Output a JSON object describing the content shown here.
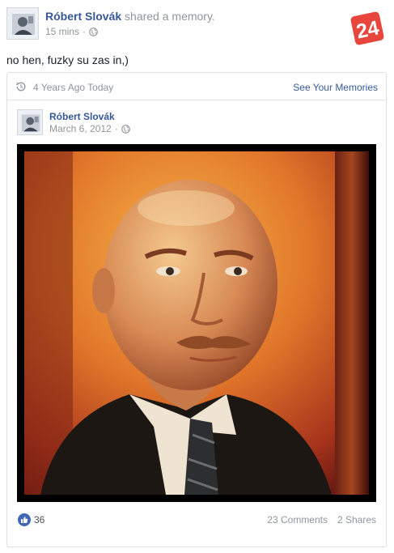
{
  "post": {
    "author": "Róbert Slovák",
    "action": "shared a memory.",
    "time": "15 mins",
    "separator": "·",
    "privacy_icon": "globe-icon",
    "text": "no hen, fuzky su zas in,)"
  },
  "logo": {
    "text": "24",
    "color": "#e8453c",
    "icon": "news-24-logo"
  },
  "memory": {
    "ago_icon": "history-clock-icon",
    "ago_label": "4 Years Ago Today",
    "see_label": "See Your Memories",
    "original": {
      "author": "Róbert Slovák",
      "date": "March 6, 2012",
      "separator": "·",
      "privacy_icon": "globe-icon"
    },
    "photo_alt": "Portrait of a man with a mustache in warm orange light"
  },
  "footer": {
    "like_icon": "like-thumb-icon",
    "likes": "36",
    "comments": "23 Comments",
    "shares": "2 Shares"
  },
  "colors": {
    "link": "#365899",
    "meta": "#90949c",
    "like_blue": "#4267b2"
  }
}
